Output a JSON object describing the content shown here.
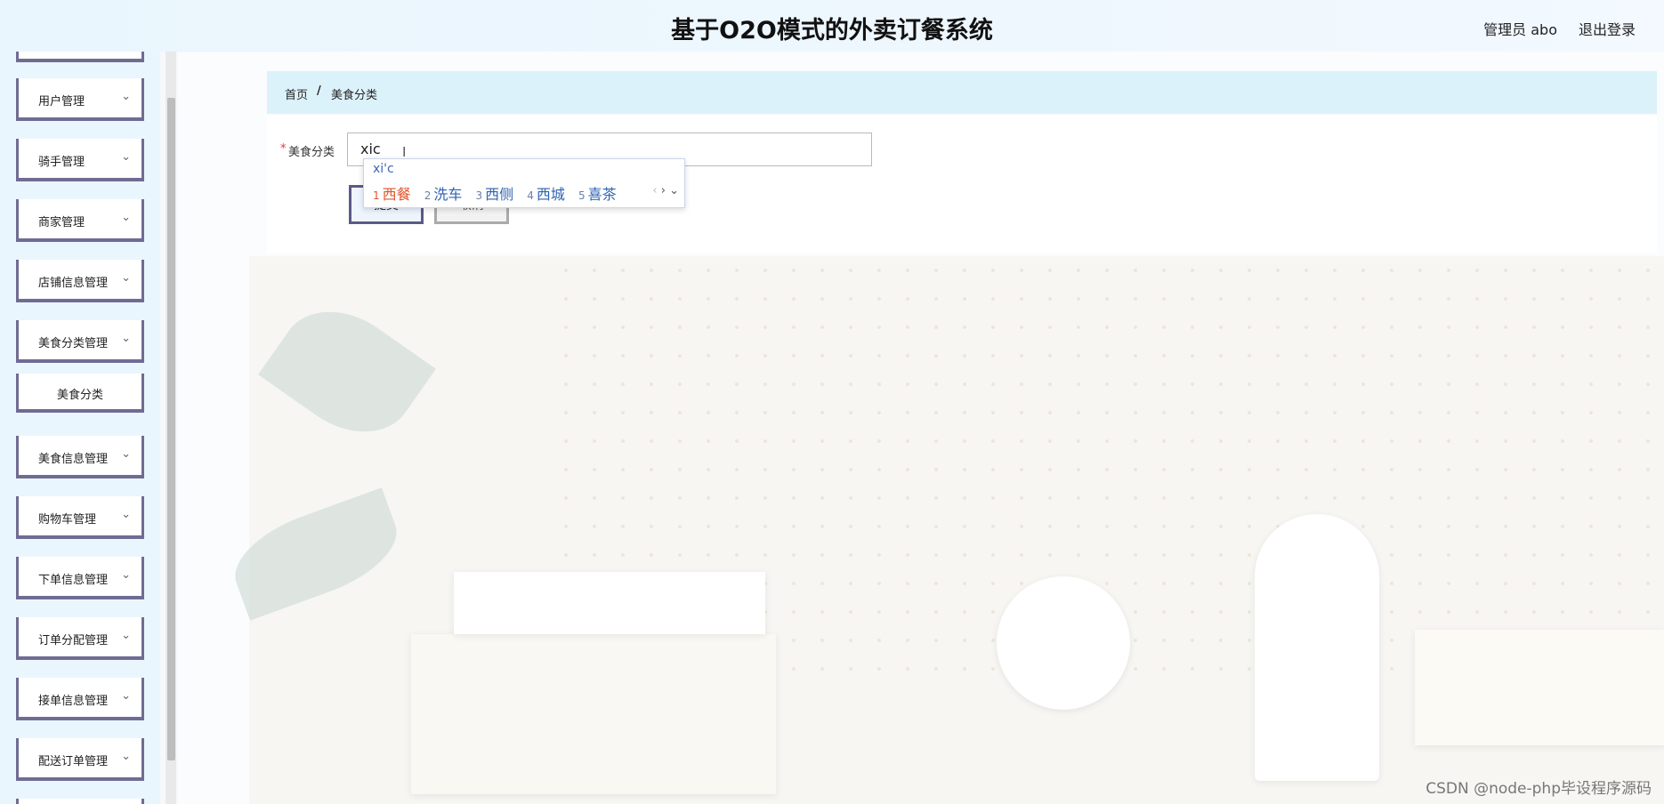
{
  "header": {
    "title": "基于O2O模式的外卖订餐系统",
    "admin": "管理员 abo",
    "logout": "退出登录"
  },
  "sidebar": {
    "items": [
      {
        "label": "用户管理"
      },
      {
        "label": "骑手管理"
      },
      {
        "label": "商家管理"
      },
      {
        "label": "店铺信息管理"
      },
      {
        "label": "美食分类管理"
      },
      {
        "label": "美食分类"
      },
      {
        "label": "美食信息管理"
      },
      {
        "label": "购物车管理"
      },
      {
        "label": "下单信息管理"
      },
      {
        "label": "订单分配管理"
      },
      {
        "label": "接单信息管理"
      },
      {
        "label": "配送订单管理"
      }
    ]
  },
  "breadcrumb": {
    "home": "首页",
    "separator": "/",
    "current": "美食分类"
  },
  "form": {
    "label": "美食分类",
    "required_mark": "*",
    "value": "xic",
    "submit": "提交",
    "cancel": "取消"
  },
  "ime": {
    "pinyin": "xi'c",
    "candidates": [
      {
        "num": "1",
        "text": "西餐"
      },
      {
        "num": "2",
        "text": "洗车"
      },
      {
        "num": "3",
        "text": "西侧"
      },
      {
        "num": "4",
        "text": "西城"
      },
      {
        "num": "5",
        "text": "喜茶"
      }
    ],
    "prev": "‹",
    "next": "›",
    "expand": "⌄"
  },
  "watermark": "CSDN @node-php毕设程序源码",
  "icons": {
    "chevron": "chevron-down-icon",
    "text-cursor": "text-cursor-icon"
  },
  "colors": {
    "accent": "#6f6c93",
    "header_bg": "#eaf6fd",
    "breadcrumb_bg": "#dcf2fb"
  }
}
